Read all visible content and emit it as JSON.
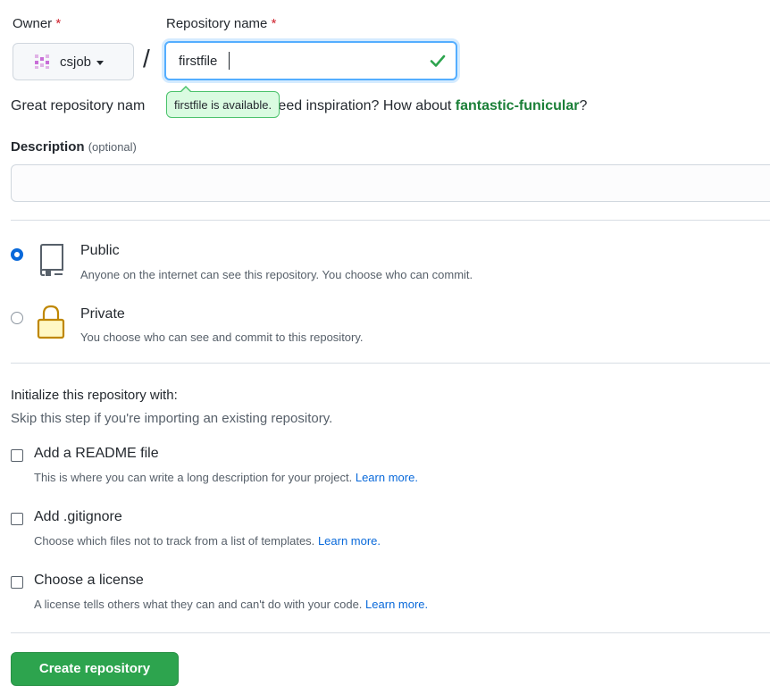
{
  "owner": {
    "label": "Owner",
    "required_mark": "*",
    "value": "csjob"
  },
  "repo_name": {
    "label": "Repository name",
    "required_mark": "*",
    "value": "firstfile",
    "separator": "/"
  },
  "availability_tooltip": "firstfile is available.",
  "name_hint": {
    "prefix": "Great repository nam",
    "middle": "emorable. Need inspiration? How about ",
    "suggestion": "fantastic-funicular",
    "suffix": "?"
  },
  "description": {
    "label": "Description",
    "optional": "(optional)",
    "value": ""
  },
  "visibility": {
    "options": [
      {
        "title": "Public",
        "description": "Anyone on the internet can see this repository. You choose who can commit.",
        "selected": true
      },
      {
        "title": "Private",
        "description": "You choose who can see and commit to this repository.",
        "selected": false
      }
    ]
  },
  "init": {
    "title": "Initialize this repository with:",
    "subtitle": "Skip this step if you're importing an existing repository.",
    "options": [
      {
        "title": "Add a README file",
        "description": "This is where you can write a long description for your project.",
        "link": "Learn more."
      },
      {
        "title": "Add .gitignore",
        "description": "Choose which files not to track from a list of templates.",
        "link": "Learn more."
      },
      {
        "title": "Choose a license",
        "description": "A license tells others what they can and can't do with your code.",
        "link": "Learn more."
      }
    ]
  },
  "submit_label": "Create repository",
  "icons": {
    "owner_avatar": "identicon-avatar",
    "availability": "check-icon",
    "public": "repo-icon",
    "private": "lock-icon"
  },
  "colors": {
    "accent_blue": "#0969da",
    "success_green": "#2da44e",
    "private_icon": "#bf8700",
    "required": "#cf222e"
  }
}
